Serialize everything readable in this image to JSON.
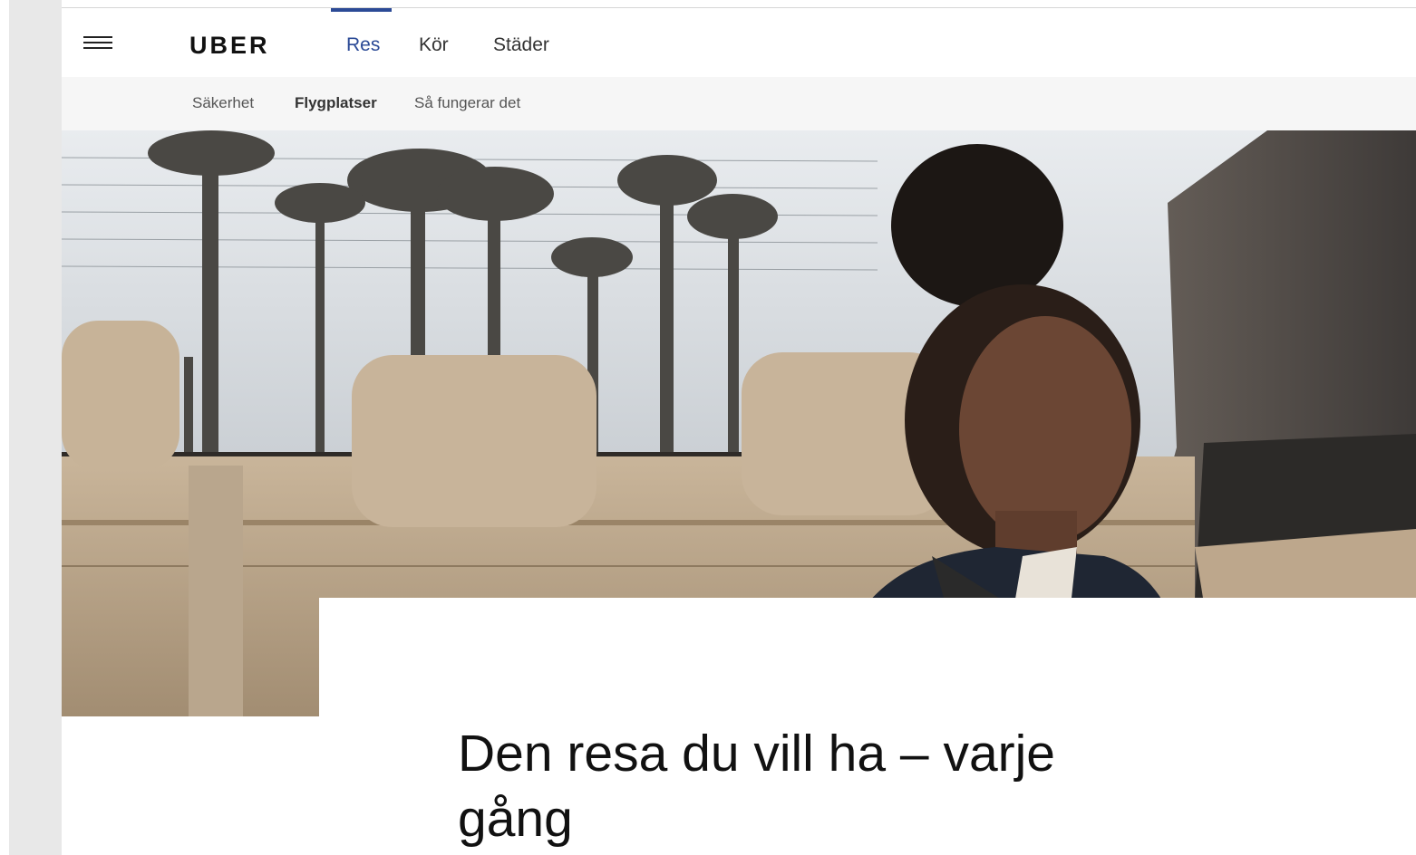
{
  "brand": {
    "logo_text": "UBER",
    "accent_color": "#2b4a96"
  },
  "topnav": {
    "menu_icon": "hamburger-menu-icon",
    "tabs": [
      {
        "label": "Res",
        "active": true
      },
      {
        "label": "Kör",
        "active": false
      },
      {
        "label": "Städer",
        "active": false
      }
    ]
  },
  "subnav": {
    "items": [
      {
        "label": "Säkerhet"
      },
      {
        "label": "Flygplatser"
      },
      {
        "label": "Så fungerar det"
      }
    ]
  },
  "hero": {
    "headline": "Den resa du vill ha – varje gång"
  }
}
